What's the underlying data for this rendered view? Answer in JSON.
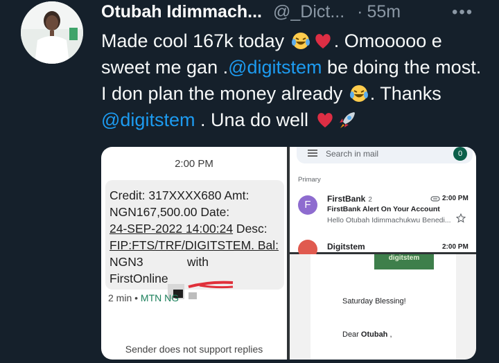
{
  "tweet": {
    "author_name": "Otubah Idimmach...",
    "handle": "@_Dict...",
    "separator": "·",
    "time_ago": "55m",
    "more_label": "•••",
    "text": {
      "p1": "Made cool 167k today",
      "p2": ". Omooooo e sweet me gan .",
      "mention1": "@digitstem",
      "p3": " be doing the most. I don plan the money already",
      "p4": ". Thanks",
      "mention2": "@digitstem",
      "p5": " . Una do well"
    },
    "emojis": [
      "laughing-tears-icon",
      "red-heart-icon",
      "laughing-tears-icon",
      "red-heart-icon",
      "rocket-icon"
    ]
  },
  "sms": {
    "time": "2:00 PM",
    "line1": "Credit: 317XXXX680 Amt:",
    "line2": "NGN167,500.00 Date:",
    "line3": "24-SEP-2022 14:00:24",
    "line3b": " Desc:",
    "line4": "FIP:FTS/TRF/DIGITSTEM. Bal:",
    "line5": "NGN3             with",
    "line6": "FirstOnline",
    "meta_time": "2 min •",
    "carrier": "MTN NG",
    "footer": "Sender does not support replies"
  },
  "mail": {
    "search_placeholder": "Search in mail",
    "unread_count": "0",
    "section": "Primary",
    "items": [
      {
        "avatar_letter": "F",
        "sender": "FirstBank",
        "count": "2",
        "time": "2:00 PM",
        "subject": "FirstBank Alert On Your Account",
        "snippet": "Hello Otubah Idimmachukwu Benedi..."
      },
      {
        "sender": "Digitstem",
        "time": "2:00 PM"
      }
    ]
  },
  "email": {
    "logo_text": "digitstem",
    "greeting": "Saturday Blessing!",
    "dear": "Dear ",
    "dear_name": "Otubah",
    "dear_tail": " ,"
  },
  "colors": {
    "background": "#15202b",
    "mention": "#1d9bf0",
    "muted": "#8b98a5"
  }
}
